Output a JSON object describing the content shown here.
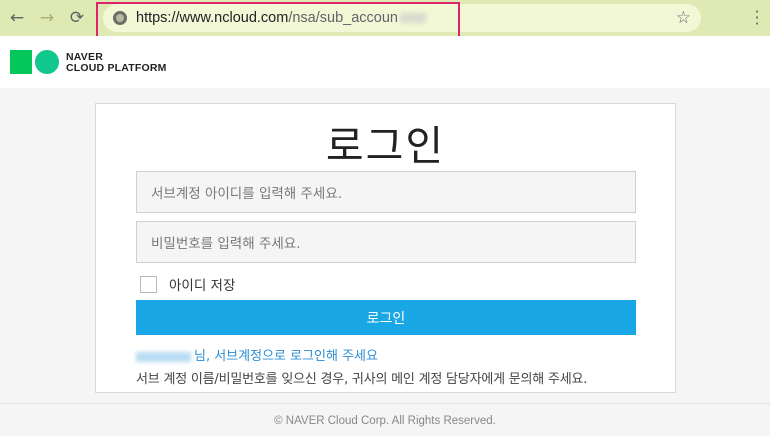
{
  "browser": {
    "back_icon": "←",
    "forward_icon": "→",
    "reload_icon": "⟳",
    "url_host": "https://www.ncloud.com",
    "url_path": "/nsa/sub_accoun",
    "star_icon": "☆",
    "menu_icon": "⋮"
  },
  "header": {
    "logo_line1": "NAVER",
    "logo_line2": "CLOUD PLATFORM",
    "brand_colors": {
      "green": "#03c75a",
      "teal": "#1cc6b6"
    }
  },
  "login": {
    "title": "로그인",
    "id_placeholder": "서브계정 아이디를 입력해 주세요.",
    "pw_placeholder": "비밀번호를 입력해 주세요.",
    "remember_label": "아이디 저장",
    "submit_label": "로그인",
    "notice_line1": "님, 서브계정으로 로그인해 주세요",
    "notice_line2": "서브 계정 이름/비밀번호를 잊으신 경우, 귀사의 메인 계정 담당자에게 문의해 주세요.",
    "accent_color": "#1aa7e6"
  },
  "footer": {
    "copyright": "© NAVER Cloud Corp. All Rights Reserved."
  }
}
